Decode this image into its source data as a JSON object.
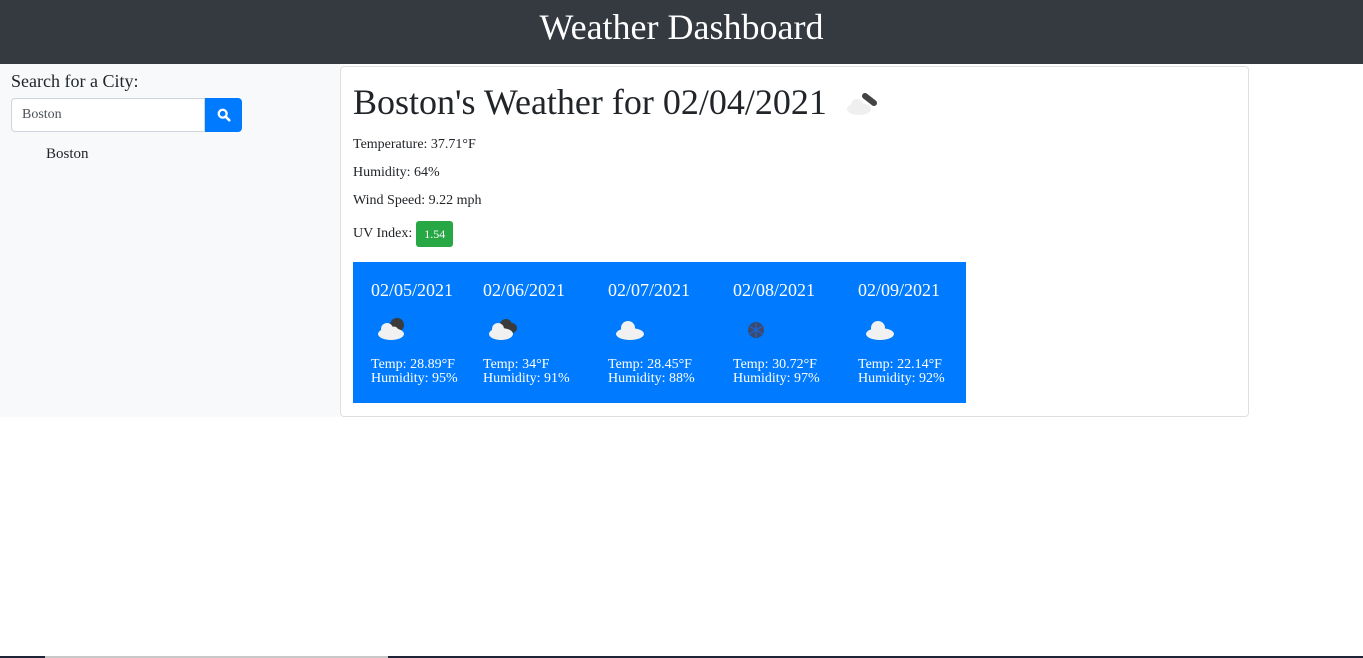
{
  "header": {
    "title": "Weather Dashboard"
  },
  "sidebar": {
    "search_label": "Search for a City:",
    "search_value": "Boston",
    "search_button_icon": "search-icon",
    "history": [
      "Boston"
    ]
  },
  "current": {
    "title": "Boston's Weather for 02/04/2021",
    "icon": "cloud-broken-icon",
    "temperature": "Temperature: 37.71°F",
    "humidity": "Humidity: 64%",
    "wind": "Wind Speed: 9.22 mph",
    "uv_label": "UV Index:",
    "uv_value": "1.54",
    "uv_color": "#28a745"
  },
  "forecast": [
    {
      "date": "02/05/2021",
      "icon": "cloud-night-icon",
      "temp": "Temp: 28.89°F",
      "humidity": "Humidity: 95%"
    },
    {
      "date": "02/06/2021",
      "icon": "broken-clouds-icon",
      "temp": "Temp: 34°F",
      "humidity": "Humidity: 91%"
    },
    {
      "date": "02/07/2021",
      "icon": "cloud-icon",
      "temp": "Temp: 28.45°F",
      "humidity": "Humidity: 88%"
    },
    {
      "date": "02/08/2021",
      "icon": "snow-icon",
      "temp": "Temp: 30.72°F",
      "humidity": "Humidity: 97%"
    },
    {
      "date": "02/09/2021",
      "icon": "cloud-icon",
      "temp": "Temp: 22.14°F",
      "humidity": "Humidity: 92%"
    }
  ],
  "colors": {
    "header_bg": "#343a40",
    "accent": "#007bff",
    "sidebar_bg": "#f8f9fa"
  }
}
